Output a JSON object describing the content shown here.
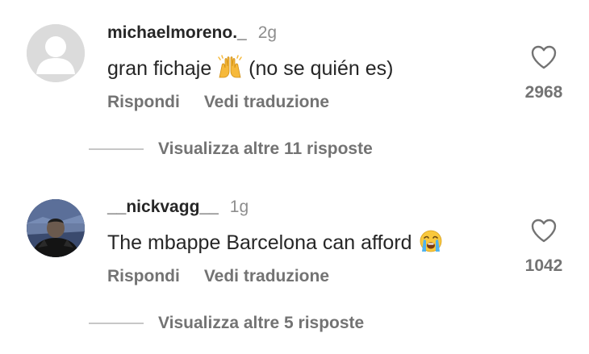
{
  "comments": [
    {
      "username": "michaelmoreno._",
      "time": "2g",
      "text_before_emoji": "gran fichaje ",
      "emoji": "raising-hands-emoji",
      "text_after_emoji": " (no se quién es)",
      "reply_label": "Rispondi",
      "translate_label": "Vedi traduzione",
      "likes": "2968",
      "view_replies": "Visualizza altre 11 risposte",
      "avatar": "default-avatar"
    },
    {
      "username": "__nickvagg__",
      "time": "1g",
      "text_before_emoji": "The mbappe Barcelona can afford ",
      "emoji": "loudly-crying-face-emoji",
      "text_after_emoji": "",
      "reply_label": "Rispondi",
      "translate_label": "Vedi traduzione",
      "likes": "1042",
      "view_replies": "Visualizza altre 5 risposte",
      "avatar": "user-photo-avatar"
    }
  ],
  "colors": {
    "primary_text": "#262626",
    "secondary_text": "#737373",
    "timestamp": "#8e8e8e",
    "divider": "#c7c7c7"
  }
}
